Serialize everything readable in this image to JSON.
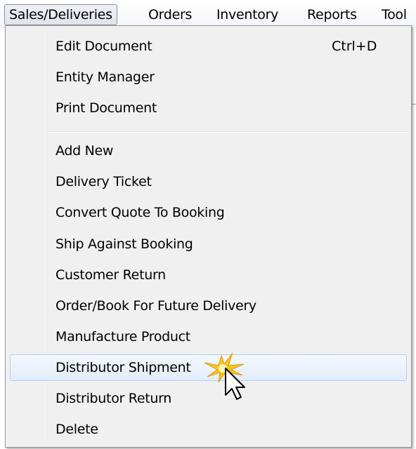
{
  "menubar": {
    "items": [
      {
        "label": "Sales/Deliveries",
        "active": true
      },
      {
        "label": "Orders"
      },
      {
        "label": "Inventory"
      },
      {
        "label": "Reports"
      },
      {
        "label": "Tool"
      }
    ]
  },
  "menu": {
    "items": [
      {
        "label": "Edit Document",
        "shortcut": "Ctrl+D"
      },
      {
        "label": "Entity Manager"
      },
      {
        "label": "Print Document"
      },
      {
        "label": "Add New"
      },
      {
        "label": "Delivery Ticket"
      },
      {
        "label": "Convert Quote To Booking"
      },
      {
        "label": "Ship Against Booking"
      },
      {
        "label": "Customer Return"
      },
      {
        "label": "Order/Book For Future Delivery"
      },
      {
        "label": "Manufacture Product"
      },
      {
        "label": "Distributor Shipment",
        "highlighted": true
      },
      {
        "label": "Distributor Return"
      },
      {
        "label": "Delete"
      }
    ]
  },
  "colors": {
    "highlight_border": "#aecff7",
    "menu_background": "#f0f0f0",
    "burst": "#f7c51e"
  },
  "icons": {
    "cursor": "arrow-cursor-icon",
    "click": "click-burst-icon"
  }
}
